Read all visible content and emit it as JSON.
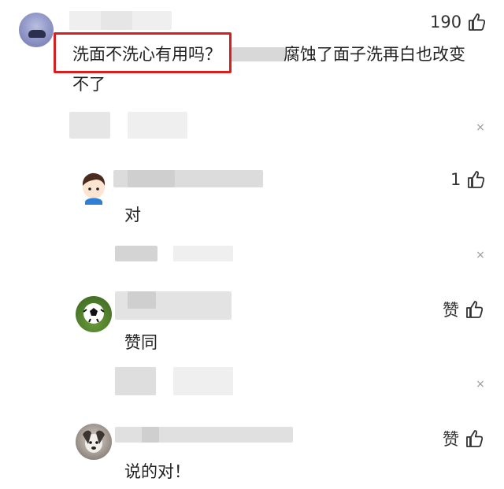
{
  "comments": [
    {
      "text_highlighted": "洗面不洗心有用吗？",
      "text_line1_rest": "腐蚀了面子洗再白也改变",
      "text_line2": "不了",
      "likes": "190"
    },
    {
      "text": "对",
      "likes": "1"
    },
    {
      "text": "赞同",
      "likes": "赞"
    },
    {
      "text": "说的对！",
      "likes": "赞"
    }
  ],
  "close_glyph": "×",
  "colors": {
    "highlight": "#d81e1e",
    "text": "#222222",
    "muted": "#999999"
  }
}
